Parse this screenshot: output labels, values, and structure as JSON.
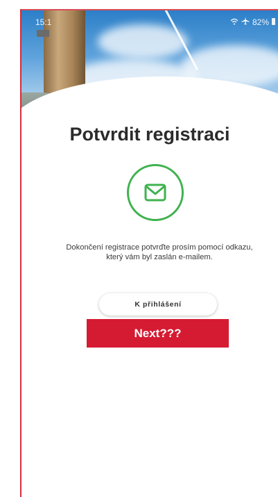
{
  "status_bar": {
    "time": "15:1",
    "signal_icons": "wifi-airplane",
    "battery": "82%"
  },
  "main": {
    "title": "Potvrdit registraci",
    "message_line1": "Dokončení registrace potvrďte prosím pomocí odkazu,",
    "message_line2": "který vám byl zaslán e-mailem.",
    "login_button_label": "K přihlášení",
    "mail_icon": "envelope-icon"
  },
  "annotation": {
    "label": "Next???",
    "color": "#d51b32"
  },
  "colors": {
    "accent_green": "#3fb24e",
    "frame_red": "#d22e3c",
    "title_text": "#2b2b2b"
  }
}
